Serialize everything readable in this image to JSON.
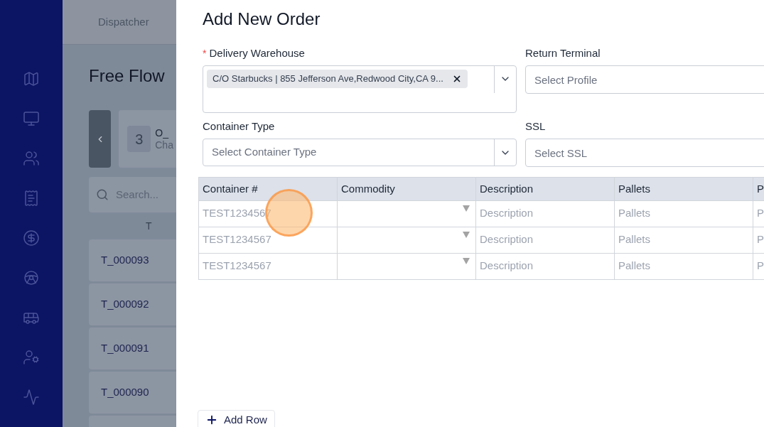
{
  "background": {
    "tab": "Dispatcher",
    "title": "Free Flow",
    "card": {
      "count": "3",
      "title": "O_",
      "subtitle": "Cha"
    },
    "search": {
      "placeholder": "Search..."
    },
    "column_header": "T",
    "rows": [
      "T_000093",
      "T_000092",
      "T_000091",
      "T_000090"
    ]
  },
  "modal": {
    "title": "Add New Order",
    "fields": [
      {
        "label": "Delivery Warehouse",
        "required_mark": "*",
        "kind": "multiselect",
        "tags": [
          "C/O Starbucks | 855 Jefferson Ave,Redwood City,CA 9..."
        ]
      },
      {
        "label": "Return Terminal",
        "kind": "input",
        "placeholder": "Select Profile"
      },
      {
        "label": "Container Type",
        "kind": "select",
        "placeholder": "Select Container Type"
      },
      {
        "label": "SSL",
        "kind": "input",
        "placeholder": "Select SSL"
      }
    ],
    "table": {
      "columns": [
        "Container #",
        "Commodity",
        "Description",
        "Pallets",
        "P"
      ],
      "rows": [
        {
          "container": "TEST1234567",
          "description": "Description",
          "pallets": "Pallets",
          "column_5": "P"
        },
        {
          "container": "TEST1234567",
          "description": "Description",
          "pallets": "Pallets",
          "column_5": "P"
        },
        {
          "container": "TEST1234567",
          "description": "Description",
          "pallets": "Pallets",
          "column_5": "P"
        }
      ]
    },
    "add_row_button": "Add Row"
  }
}
